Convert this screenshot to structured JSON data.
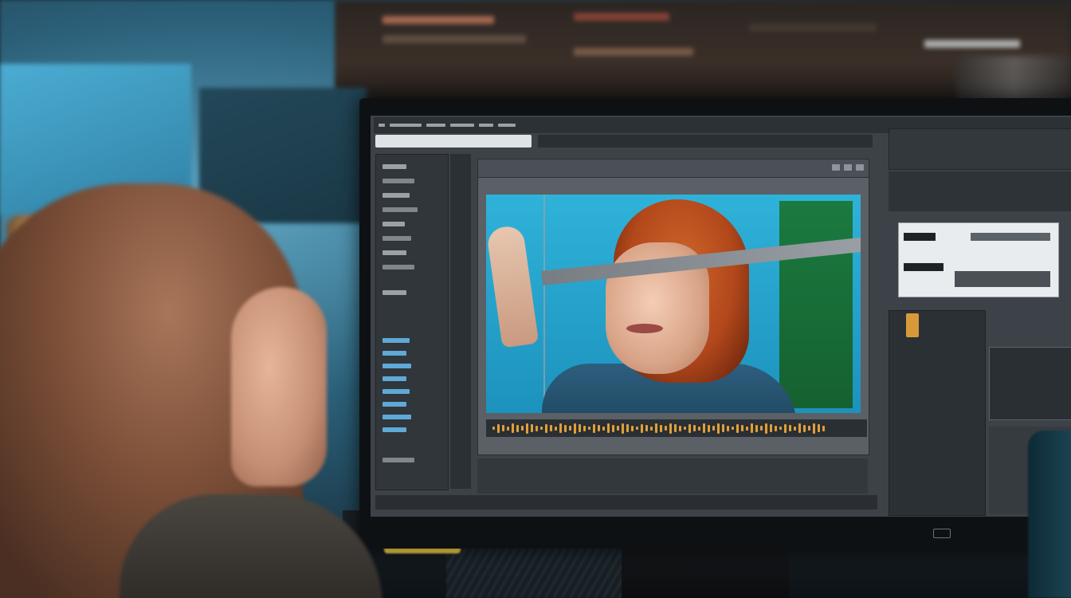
{
  "scene": {
    "subject": "photo",
    "colors": {
      "ambient_teal": "#2b5f78",
      "monitor_bezel": "#0e1114",
      "editor_ui_gray": "#3c4248",
      "viewer_backdrop": "#2fb2d9",
      "green_screen": "#1b7a3f",
      "subject_hair": "#c0531f",
      "woman_hair": "#7c4f38",
      "desk_light": "#f2d34a"
    }
  }
}
